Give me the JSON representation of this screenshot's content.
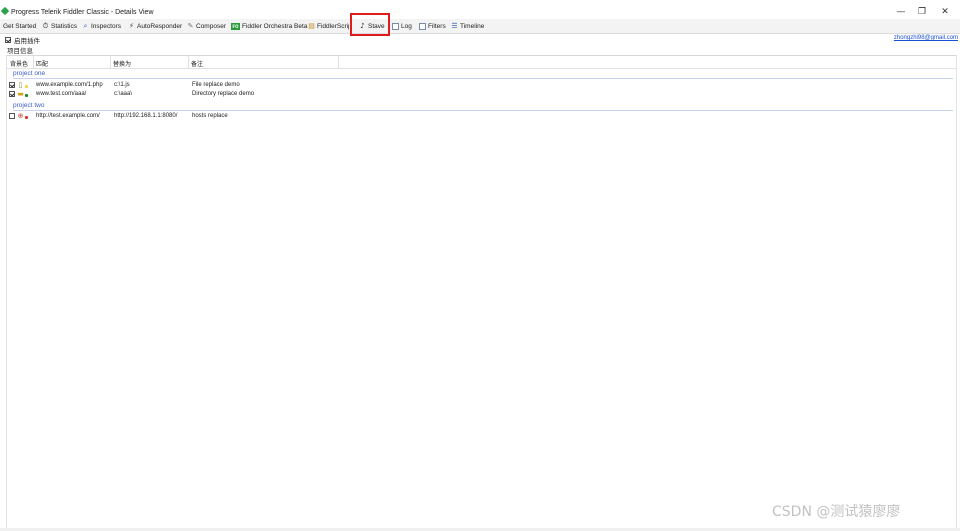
{
  "window": {
    "title": "Progress Telerik Fiddler Classic - Details View",
    "controls": {
      "minimize": "—",
      "restore": "❐",
      "close": "✕"
    }
  },
  "tabs": [
    {
      "label": "Get Started",
      "icon": "none"
    },
    {
      "label": "Statistics",
      "icon": "stopwatch-icon"
    },
    {
      "label": "Inspectors",
      "icon": "magnifier-icon"
    },
    {
      "label": "AutoResponder",
      "icon": "lightning-icon"
    },
    {
      "label": "Composer",
      "icon": "compose-icon"
    },
    {
      "label": "Fiddler Orchestra Beta",
      "icon": "fo-icon",
      "icon_text": "FO"
    },
    {
      "label": "FiddlerScript",
      "icon": "script-icon"
    },
    {
      "label": "Stave",
      "icon": "music-note-icon",
      "active": true
    },
    {
      "label": "Log",
      "icon": "log-icon"
    },
    {
      "label": "Filters",
      "icon": "checkbox-icon"
    },
    {
      "label": "Timeline",
      "icon": "timeline-icon"
    }
  ],
  "toolbar": {
    "enable_plugin_label": "启用插件",
    "enable_plugin_checked": true,
    "email": "zhongzhi98@gmail.com"
  },
  "project_info_label": "项目信息",
  "columns": [
    "背景色",
    "匹配",
    "替换为",
    "备注"
  ],
  "groups": [
    {
      "name": "project one",
      "rows": [
        {
          "checked": true,
          "icon": "file-icon",
          "color": "#f2d74a",
          "match": "www.example.com/1.php",
          "replace": "c:\\1.js",
          "note": "File replace demo"
        },
        {
          "checked": true,
          "icon": "folder-icon",
          "color": "#1c8a2a",
          "match": "www.test.com/aaa/",
          "replace": "c:\\aaa\\",
          "note": "Directory replace demo"
        }
      ]
    },
    {
      "name": "project two",
      "rows": [
        {
          "checked": false,
          "icon": "globe-icon",
          "color": "#e0322a",
          "match": "http://test.example.com/",
          "replace": "http://192.168.1.1:8080/",
          "note": "hosts replace"
        }
      ]
    }
  ],
  "watermark": "CSDN @测试猿廖廖",
  "colors": {
    "highlight": "#e01b1b",
    "group_text": "#3b5bc7",
    "link": "#1a4fd8"
  }
}
